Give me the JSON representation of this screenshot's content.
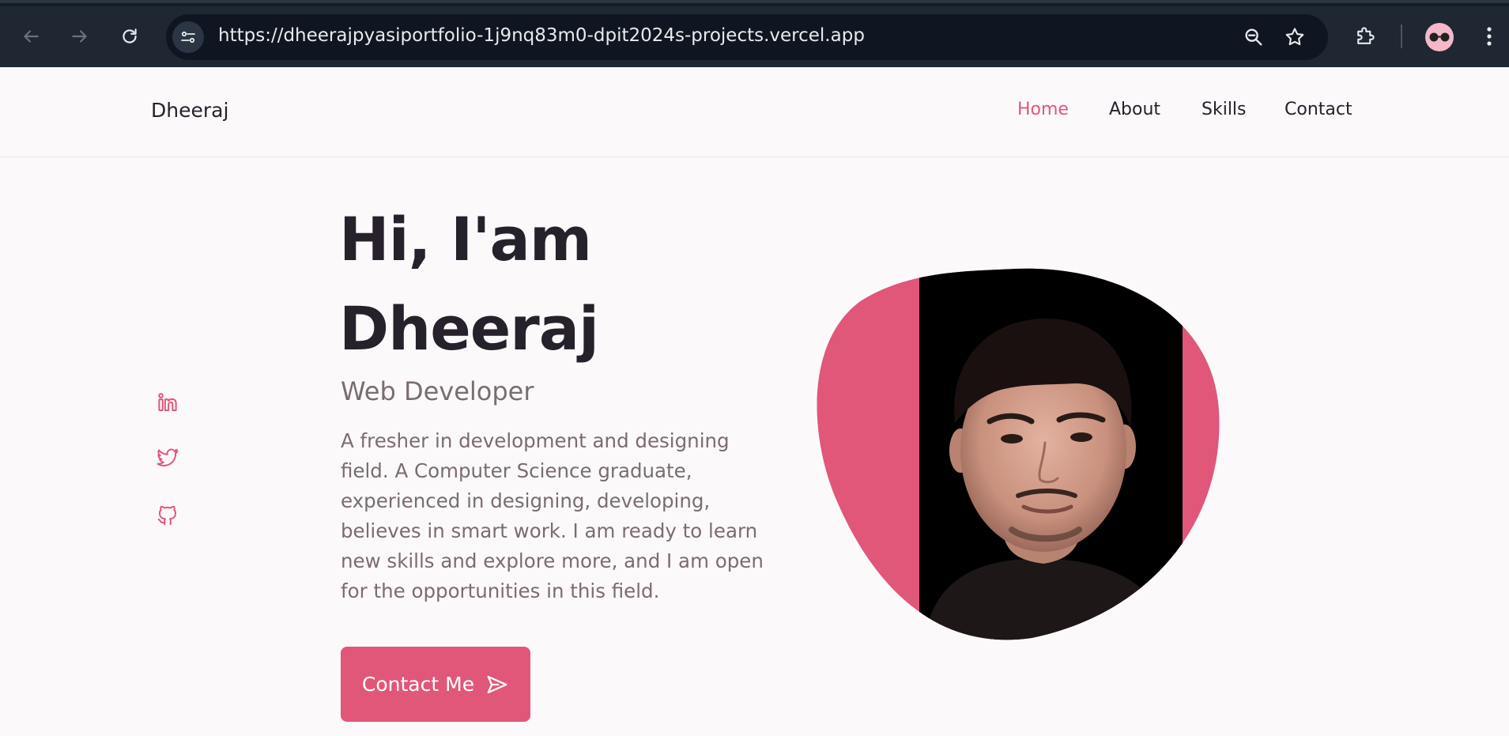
{
  "browser": {
    "url": "https://dheerajpyasiportfolio-1j9nq83m0-dpit2024s-projects.vercel.app",
    "icons": [
      "back-arrow-icon",
      "forward-arrow-icon",
      "reload-icon",
      "site-settings-icon",
      "zoom-out-icon",
      "bookmark-star-icon",
      "extensions-puzzle-icon",
      "profile-avatar",
      "more-menu-icon"
    ]
  },
  "header": {
    "logo": "Dheeraj",
    "nav": [
      {
        "label": "Home",
        "active": true
      },
      {
        "label": "About",
        "active": false
      },
      {
        "label": "Skills",
        "active": false
      },
      {
        "label": "Contact",
        "active": false
      }
    ]
  },
  "social": [
    "linkedin-icon",
    "twitter-icon",
    "github-icon"
  ],
  "hero": {
    "title_line1": "Hi, I'am",
    "title_line2": "Dheeraj",
    "subtitle": "Web Developer",
    "description": "A fresher in development and designing field. A Computer Science graduate, experienced in designing, developing, believes in smart work. I am ready to learn new skills and explore more, and I am open for the opportunities in this field.",
    "cta_label": "Contact Me"
  },
  "colors": {
    "accent": "#e0577a",
    "text_dark": "#26212a",
    "text_muted": "#7b6b72",
    "background": "#fcf9fb",
    "chrome_bg": "#1f2733"
  }
}
